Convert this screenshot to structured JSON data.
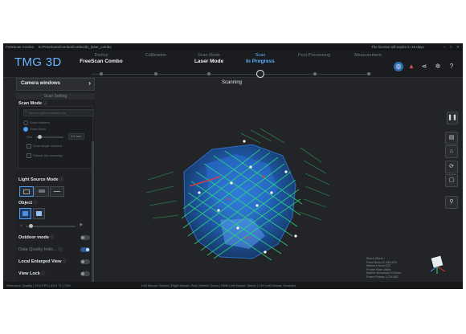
{
  "titlebar": {
    "app": "FreeScan Combo",
    "path": "E:/FreeScan/Combo/Combo/dc_laser_combo",
    "notice": "The license will expire in 15 days"
  },
  "logo": "TMG 3D",
  "steps": [
    {
      "top": "Device",
      "bottom": "FreeScan Combo",
      "active": false
    },
    {
      "top": "Calibration",
      "bottom": "",
      "active": false
    },
    {
      "top": "Scan Mode",
      "bottom": "Laser Mode",
      "active": false
    },
    {
      "top": "Scan",
      "bottom": "In Progress",
      "active": true
    },
    {
      "top": "Post-Processing",
      "bottom": "",
      "active": false
    },
    {
      "top": "Measurement",
      "bottom": "",
      "active": false
    }
  ],
  "top_icons": [
    "globe-icon",
    "warning-icon",
    "share-icon",
    "settings-icon",
    "help-icon"
  ],
  "panel": {
    "camera_windows": "Camera windows",
    "scan_setting": "Scan Setting",
    "scan_mode": "Scan Mode",
    "search_placeholder": "Search global markers file",
    "opt_marker": "Scan Markers",
    "opt_mesh": "Scan Mesh",
    "res_label": "Res",
    "res_value": "0.5",
    "res_unit": "mm",
    "opt_single": "Scan single markers",
    "opt_retake": "Retake the scanning",
    "light_source_mode": "Light Source Mode",
    "object": "Object",
    "outdoor_mode": "Outdoor mode",
    "data_quality": "Data Quality Indic...",
    "local_enlarged": "Local Enlarged View",
    "view_lock": "View Lock",
    "outdoor_on": false,
    "data_quality_on": true,
    "local_enlarged_on": false,
    "view_lock_on": false
  },
  "viewport": {
    "status": "Scanning"
  },
  "right_toolbar": [
    "pause-icon",
    "layers-icon",
    "home-icon",
    "rotate-icon",
    "delete-icon",
    "pin-icon"
  ],
  "stats": [
    "Res:1.00mm",
    "Point Num:12,345,678",
    "Markers Num:123",
    "Frame Rate:16fps",
    "Marker Accuracy:0.03mm",
    "Fused Points:1,234,567"
  ],
  "status": {
    "left": "Reference Quality | 23.4 FPS | 49.0 °C | 74%",
    "center": "Left Mouse: Rotate | Right Mouse: Pan | Wheel: Zoom | Shift+Left Mouse: Select | Ctrl+Left Mouse: Deselect"
  }
}
